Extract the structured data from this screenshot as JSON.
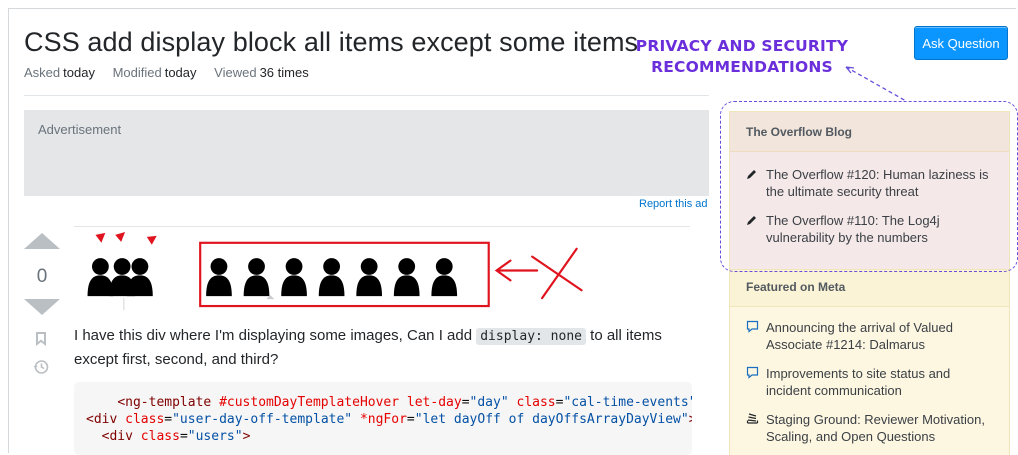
{
  "question": {
    "title": "CSS add display block all items except some items",
    "meta": [
      {
        "label": "Asked",
        "value": "today"
      },
      {
        "label": "Modified",
        "value": "today"
      },
      {
        "label": "Viewed",
        "value": "36 times"
      }
    ]
  },
  "header": {
    "ask_button": "Ask Question"
  },
  "annotation": {
    "line1": "PRIVACY AND SECURITY",
    "line2": "RECOMMENDATIONS",
    "color": "#6a2edb"
  },
  "advertisement": {
    "label": "Advertisement",
    "report_link": "Report this ad"
  },
  "post": {
    "vote_count": "0",
    "text_before_code": "I have this div where I'm displaying some images, Can I add ",
    "inline_code": "display: none",
    "text_after_code": " to all items except first, second, and third?",
    "code_lines": [
      "    <ng-template #customDayTemplateHover let-day=\"day\" class=\"cal-time-events\">",
      "<div class=\"user-day-off-template\" *ngFor=\"let dayOff of dayOffsArrayDayView\">",
      "  <div class=\"users\">"
    ]
  },
  "sidebar": {
    "blog": {
      "title": "The Overflow Blog",
      "items": [
        {
          "icon": "pencil-icon",
          "text": "The Overflow #120: Human laziness is the ultimate security threat"
        },
        {
          "icon": "pencil-icon",
          "text": "The Overflow #110: The Log4j vulnerability by the numbers"
        }
      ]
    },
    "meta": {
      "title": "Featured on Meta",
      "items": [
        {
          "icon": "chat-bubble-icon",
          "text": "Announcing the arrival of Valued Associate #1214: Dalmarus"
        },
        {
          "icon": "chat-bubble-icon",
          "text": "Improvements to site status and incident communication"
        },
        {
          "icon": "stack-icon",
          "text": "Staging Ground: Reviewer Motivation, Scaling, and Open Questions"
        }
      ]
    }
  },
  "colors": {
    "accent": "#0a95ff",
    "link": "#0074cc",
    "highlight_box": "#e0141e"
  }
}
